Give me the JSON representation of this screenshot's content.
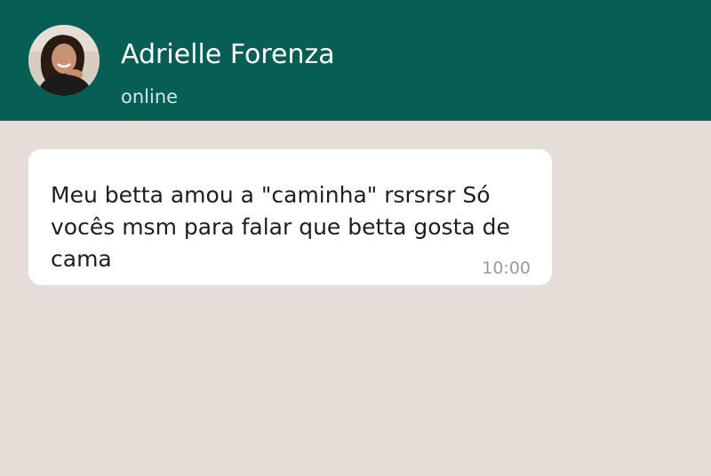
{
  "header": {
    "contact_name": "Adrielle Forenza",
    "status": "online",
    "avatar_icon": "contact-avatar"
  },
  "conversation": {
    "messages": [
      {
        "text": "Meu betta amou a \"caminha\" rsrsrsr Só vocês msm para falar que betta gosta de cama",
        "time": "10:00",
        "direction": "incoming"
      }
    ]
  },
  "colors": {
    "header_bg": "#075e55",
    "chat_bg": "#e5ddd8",
    "bubble_bg": "#ffffff",
    "name_text": "#ffffff",
    "status_text": "#d3e6e3",
    "message_text": "#1e1e1e",
    "time_text": "#9a9a9a"
  }
}
